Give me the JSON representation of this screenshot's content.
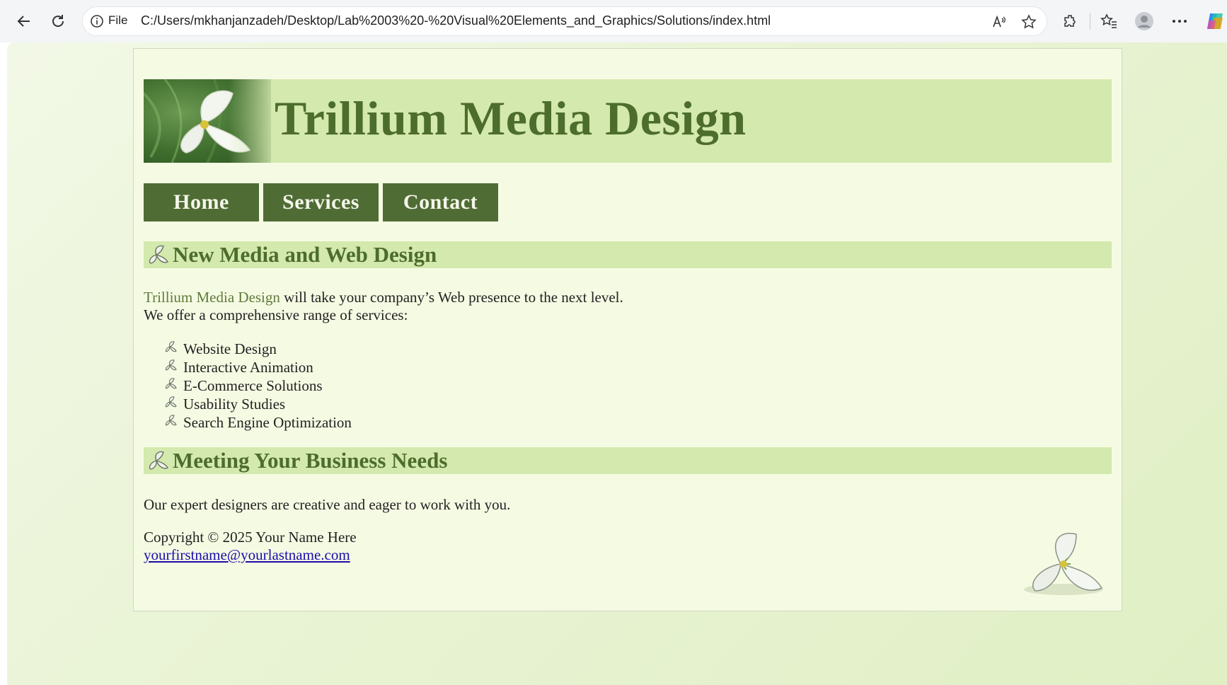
{
  "browser": {
    "file_label": "File",
    "url": "C:/Users/mkhanjanzadeh/Desktop/Lab%2003%20-%20Visual%20Elements_and_Graphics/Solutions/index.html",
    "icons": [
      "back-icon",
      "refresh-icon",
      "info-icon",
      "read-aloud-icon",
      "favorite-star-icon",
      "extensions-icon",
      "favorites-icon",
      "profile-icon",
      "more-icon",
      "copilot-icon"
    ]
  },
  "site": {
    "title": "Trillium Media Design",
    "nav": [
      {
        "label": "Home"
      },
      {
        "label": "Services"
      },
      {
        "label": "Contact"
      }
    ],
    "section1": {
      "heading": "New Media and Web Design",
      "brand": "Trillium Media Design",
      "line1_rest": " will take your company’s Web presence to the next level.",
      "line2": "We offer a comprehensive range of services:",
      "services": [
        "Website Design",
        "Interactive Animation",
        "E-Commerce Solutions",
        "Usability Studies",
        "Search Engine Optimization"
      ]
    },
    "section2": {
      "heading": "Meeting Your Business Needs",
      "text": "Our expert designers are creative and eager to work with you."
    },
    "footer": {
      "copyright": "Copyright © 2025 Your Name Here",
      "email": "yourfirstname@yourlastname.com"
    }
  },
  "colors": {
    "header_band": "#d4e9ae",
    "heading_text": "#4d6d2c",
    "nav_bg": "#4f6c34",
    "link": "#1a0dab"
  }
}
